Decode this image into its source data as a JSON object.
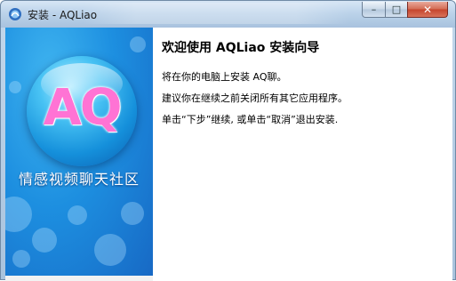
{
  "window": {
    "title": "安装 - AQLiao",
    "controls": {
      "minimize": "–",
      "maximize": "□",
      "close": "✕"
    }
  },
  "left_panel": {
    "logo_text": "AQ",
    "slogan": "情感视频聊天社区",
    "colors": {
      "background": "#1d8fe0",
      "logo": "#ff73d4"
    }
  },
  "content": {
    "heading": "欢迎使用 AQLiao 安装向导",
    "paragraphs": [
      "将在你的电脑上安装 AQ聊。",
      "建议你在继续之前关闭所有其它应用程序。",
      "单击“下步”继续, 或单击“取消”退出安装."
    ]
  },
  "icons": {
    "app": "installer-icon",
    "minimize": "minimize-icon",
    "maximize": "maximize-icon",
    "close": "close-icon"
  }
}
